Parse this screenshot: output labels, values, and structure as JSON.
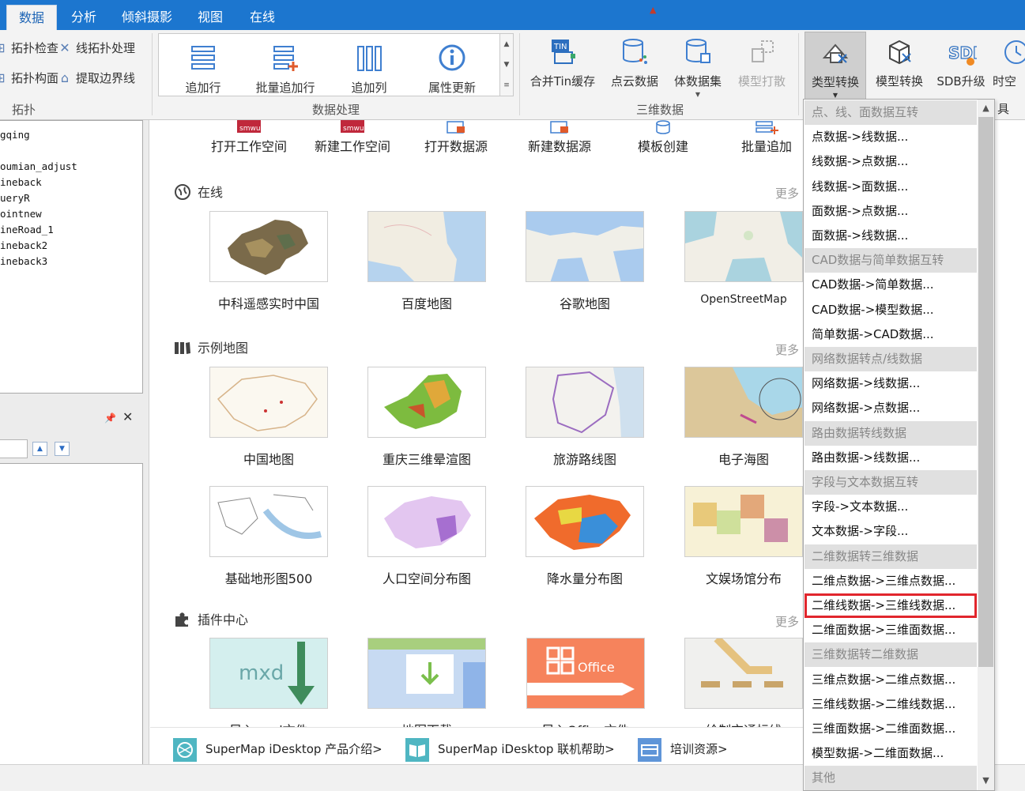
{
  "menu": {
    "tabs": [
      {
        "label": "数据",
        "active": true
      },
      {
        "label": "分析",
        "active": false
      },
      {
        "label": "倾斜摄影",
        "active": false
      },
      {
        "label": "视图",
        "active": false
      },
      {
        "label": "在线",
        "active": false
      }
    ]
  },
  "ribbon": {
    "topology": {
      "items": [
        "拓扑检查",
        "线拓扑处理",
        "拓扑构面",
        "提取边界线"
      ],
      "group_label": "拓扑"
    },
    "data_processing": {
      "buttons": [
        "追加行",
        "批量追加行",
        "追加列",
        "属性更新"
      ],
      "group_label": "数据处理"
    },
    "data_3d": {
      "buttons": [
        "合并Tin缓存",
        "点云数据",
        "体数据集",
        "模型打散"
      ],
      "group_label": "三维数据"
    },
    "type_convert": {
      "label": "类型转换"
    },
    "model_convert": {
      "label": "模型转换"
    },
    "sdb_upgrade": {
      "label": "SDB升级"
    },
    "spacetime": {
      "label": "时空"
    },
    "trailing_text": "具"
  },
  "left_panel": {
    "tree_items": [
      "gqing",
      "",
      "oumian_adjust",
      "ineback",
      "ueryR",
      "ointnew",
      "ineRoad_1",
      "ineback2",
      "ineback3"
    ]
  },
  "main": {
    "quick_actions": [
      "打开工作空间",
      "新建工作空间",
      "打开数据源",
      "新建数据源",
      "模板创建",
      "批量追加"
    ],
    "more_label": "更多",
    "sections": {
      "online": {
        "title": "在线",
        "cards": [
          "中科遥感实时中国",
          "百度地图",
          "谷歌地图",
          "OpenStreetMap"
        ]
      },
      "samples": {
        "title": "示例地图",
        "cards": [
          "中国地图",
          "重庆三维晕渲图",
          "旅游路线图",
          "电子海图",
          "基础地形图500",
          "人口空间分布图",
          "降水量分布图",
          "文娱场馆分布"
        ]
      },
      "plugins": {
        "title": "插件中心",
        "cards": [
          "导入mxd文件",
          "地图下载",
          "导入Office文件",
          "绘制交通标线"
        ],
        "mxd_text": "mxd",
        "office_text": "Office"
      }
    },
    "footer_links": [
      "SuperMap iDesktop 产品介绍>",
      "SuperMap iDesktop 联机帮助>",
      "培训资源>"
    ]
  },
  "dropdown": {
    "items": [
      {
        "label": "点、线、面数据互转",
        "type": "header"
      },
      {
        "label": "点数据->线数据...",
        "type": "item"
      },
      {
        "label": "线数据->点数据...",
        "type": "item"
      },
      {
        "label": "线数据->面数据...",
        "type": "item"
      },
      {
        "label": "面数据->点数据...",
        "type": "item"
      },
      {
        "label": "面数据->线数据...",
        "type": "item"
      },
      {
        "label": "CAD数据与简单数据互转",
        "type": "header"
      },
      {
        "label": "CAD数据->简单数据...",
        "type": "item"
      },
      {
        "label": "CAD数据->模型数据...",
        "type": "item"
      },
      {
        "label": "简单数据->CAD数据...",
        "type": "item"
      },
      {
        "label": "网络数据转点/线数据",
        "type": "header"
      },
      {
        "label": "网络数据->线数据...",
        "type": "item"
      },
      {
        "label": "网络数据->点数据...",
        "type": "item"
      },
      {
        "label": "路由数据转线数据",
        "type": "header"
      },
      {
        "label": "路由数据->线数据...",
        "type": "item"
      },
      {
        "label": "字段与文本数据互转",
        "type": "header"
      },
      {
        "label": "字段->文本数据...",
        "type": "item"
      },
      {
        "label": "文本数据->字段...",
        "type": "item"
      },
      {
        "label": "二维数据转三维数据",
        "type": "header"
      },
      {
        "label": "二维点数据->三维点数据...",
        "type": "item"
      },
      {
        "label": "二维线数据->三维线数据...",
        "type": "item",
        "highlighted": true
      },
      {
        "label": "二维面数据->三维面数据...",
        "type": "item"
      },
      {
        "label": "三维数据转二维数据",
        "type": "header"
      },
      {
        "label": "三维点数据->二维点数据...",
        "type": "item"
      },
      {
        "label": "三维线数据->二维线数据...",
        "type": "item"
      },
      {
        "label": "三维面数据->二维面数据...",
        "type": "item"
      },
      {
        "label": "模型数据->二维面数据...",
        "type": "item"
      },
      {
        "label": "其他",
        "type": "header"
      }
    ]
  },
  "colors": {
    "accent": "#1c76cf",
    "highlight_outline": "#e1262d",
    "menu_header_bg": "#e0e0e0"
  }
}
